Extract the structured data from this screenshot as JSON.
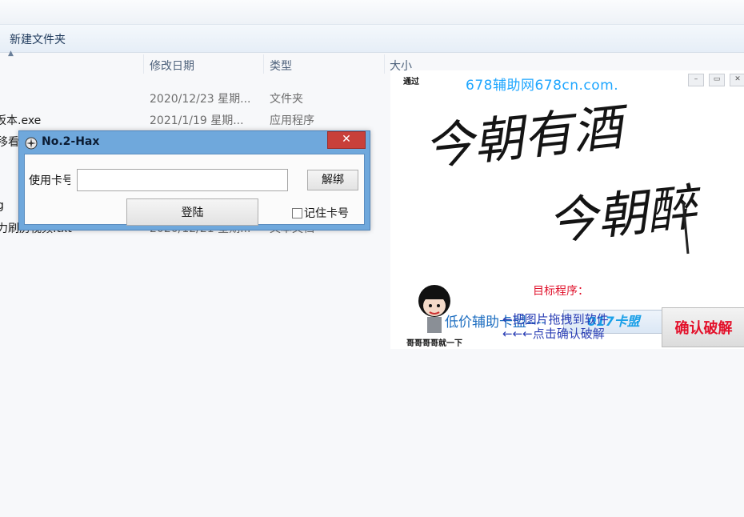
{
  "explorer": {
    "toolbar": {
      "new_folder_label": "新建文件夹"
    },
    "columns": {
      "date_modified": "修改日期",
      "type": "类型",
      "size": "大小"
    },
    "rows": [
      {
        "name": "",
        "date": "2020/12/23 星期...",
        "type": "文件夹"
      },
      {
        "name": "坂本.exe",
        "date": "2021/1/19 星期...",
        "type": "应用程序"
      },
      {
        "name": "移看.",
        "date": "",
        "type": ""
      },
      {
        "name": "g",
        "date": "",
        "type": ""
      },
      {
        "name": "力刷房视频.txt",
        "date": "2020/12/21 星期...",
        "type": "文本文档"
      }
    ]
  },
  "promo": {
    "tiny_logo": "通过",
    "url": "678辅助网678cn.com.",
    "calligraphy_line1": "今朝有酒",
    "calligraphy_line2": "今朝醉",
    "slogan": "低价辅助卡盟----",
    "badge": "017卡盟",
    "target_label": "目标程序：",
    "hint1": "←把图片拖拽到软件",
    "hint2": "←←←点击确认破解",
    "face_caption": "哥哥哥哥就一下",
    "confirm_label": "确认破解"
  },
  "dialog": {
    "title": "No.2-Hax",
    "close": "✕",
    "card_label": "使用卡号",
    "card_value": "",
    "unbind_label": "解绑",
    "login_label": "登陆",
    "remember_label": "记住卡号"
  }
}
